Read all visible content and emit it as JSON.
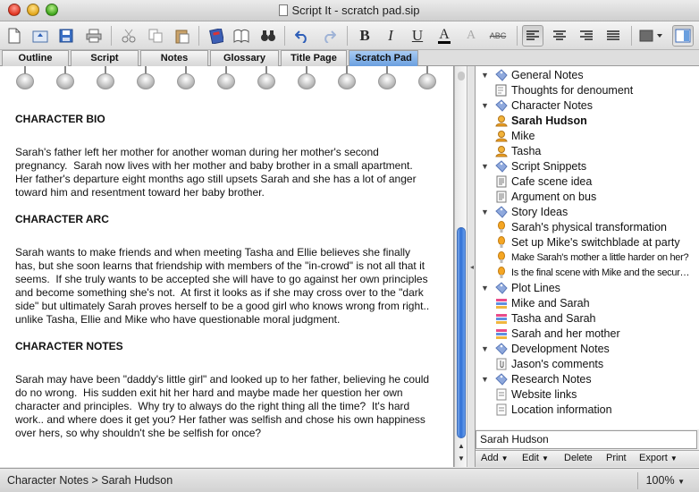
{
  "window": {
    "title": "Script It - scratch pad.sip"
  },
  "toolbar": {
    "items": [
      "new-document-icon",
      "open-icon",
      "save-icon",
      "print-icon",
      "cut-icon",
      "copy-icon",
      "paste-icon",
      "notebook-icon",
      "book-icon",
      "binoculars-icon",
      "undo-icon",
      "redo-icon",
      "bold-icon",
      "italic-icon",
      "underline-icon",
      "text-color-icon",
      "highlight-icon",
      "strikethrough-icon",
      "align-left-icon",
      "align-center-icon",
      "align-right-icon",
      "justify-icon",
      "color-swatch-icon",
      "sidebar-toggle-icon"
    ],
    "bold_label": "B",
    "italic_label": "I",
    "underline_label": "U",
    "color_label": "A",
    "highlight_label": "A",
    "strike_label": "ABC"
  },
  "tabs": [
    {
      "label": "Outline",
      "active": false
    },
    {
      "label": "Script",
      "active": false
    },
    {
      "label": "Notes",
      "active": false
    },
    {
      "label": "Glossary",
      "active": false
    },
    {
      "label": "Title Page",
      "active": false
    },
    {
      "label": "Scratch Pad",
      "active": true
    }
  ],
  "editor": {
    "sections": [
      {
        "heading": "CHARACTER BIO",
        "body": "Sarah's father left her mother for another woman during her mother's second\npregnancy.  Sarah now lives with her mother and baby brother in a small apartment.\nHer father's departure eight months ago still upsets Sarah and she has a lot of anger\ntoward him and resentment toward her baby brother."
      },
      {
        "heading": "CHARACTER ARC",
        "body": "Sarah wants to make friends and when meeting Tasha and Ellie believes she finally\nhas, but she soon learns that friendship with members of the \"in-crowd\" is not all that it\nseems.  If she truly wants to be accepted she will have to go against her own principles\nand become something she's not.  At first it looks as if she may cross over to the \"dark\nside\" but ultimately Sarah proves herself to be a good girl who knows wrong from right..\nunlike Tasha, Ellie and Mike who have questionable moral judgment."
      },
      {
        "heading": "CHARACTER NOTES",
        "body": "Sarah may have been \"daddy's little girl\" and looked up to her father, believing he could\ndo no wrong.  His sudden exit hit her hard and maybe made her question her own\ncharacter and principles.  Why try to always do the right thing all the time?  It's hard\nwork.. and where does it get you? Her father was selfish and chose his own happiness\nover hers, so why shouldn't she be selfish for once?"
      }
    ]
  },
  "tree": [
    {
      "label": "General Notes",
      "type": "group",
      "icon": "tag-icon"
    },
    {
      "label": "Thoughts for denoument",
      "type": "child",
      "icon": "note-icon"
    },
    {
      "label": "Character Notes",
      "type": "group",
      "icon": "tag-icon"
    },
    {
      "label": "Sarah Hudson",
      "type": "child",
      "icon": "person-icon",
      "selected": true
    },
    {
      "label": "Mike",
      "type": "child",
      "icon": "person-icon"
    },
    {
      "label": "Tasha",
      "type": "child",
      "icon": "person-icon"
    },
    {
      "label": "Script Snippets",
      "type": "group",
      "icon": "tag-icon"
    },
    {
      "label": "Cafe scene idea",
      "type": "child",
      "icon": "snippet-icon"
    },
    {
      "label": "Argument on bus",
      "type": "child",
      "icon": "snippet-icon"
    },
    {
      "label": "Story Ideas",
      "type": "group",
      "icon": "tag-icon"
    },
    {
      "label": "Sarah's physical transformation",
      "type": "child",
      "icon": "lightbulb-icon"
    },
    {
      "label": "Set up Mike's switchblade at party",
      "type": "child",
      "icon": "lightbulb-icon"
    },
    {
      "label": "Make Sarah's mother a little harder on her?",
      "type": "child",
      "icon": "lightbulb-icon",
      "small": true
    },
    {
      "label": "Is the final scene with Mike and the secur…",
      "type": "child",
      "icon": "lightbulb-icon",
      "small": true
    },
    {
      "label": "Plot Lines",
      "type": "group",
      "icon": "tag-icon"
    },
    {
      "label": "Mike and Sarah",
      "type": "child",
      "icon": "plotline-icon"
    },
    {
      "label": "Tasha and Sarah",
      "type": "child",
      "icon": "plotline-icon"
    },
    {
      "label": "Sarah and her mother",
      "type": "child",
      "icon": "plotline-icon"
    },
    {
      "label": "Development Notes",
      "type": "group",
      "icon": "tag-icon"
    },
    {
      "label": "Jason's comments",
      "type": "child",
      "icon": "paperclip-icon"
    },
    {
      "label": "Research Notes",
      "type": "group",
      "icon": "tag-icon"
    },
    {
      "label": "Website links",
      "type": "child",
      "icon": "link-icon"
    },
    {
      "label": "Location information",
      "type": "child",
      "icon": "link-icon"
    }
  ],
  "selected_name": "Sarah Hudson",
  "sidebar_buttons": {
    "add": "Add",
    "edit": "Edit",
    "delete": "Delete",
    "print": "Print",
    "export": "Export"
  },
  "status": {
    "breadcrumb": "Character Notes > Sarah Hudson",
    "zoom": "100%"
  },
  "colors": {
    "tab_active": "#6a9fdf",
    "scroll_thumb": "#2f6fd6",
    "tag_blue": "#7f9bd6",
    "person_orange": "#f0a020",
    "bulb_orange": "#f5a623"
  }
}
